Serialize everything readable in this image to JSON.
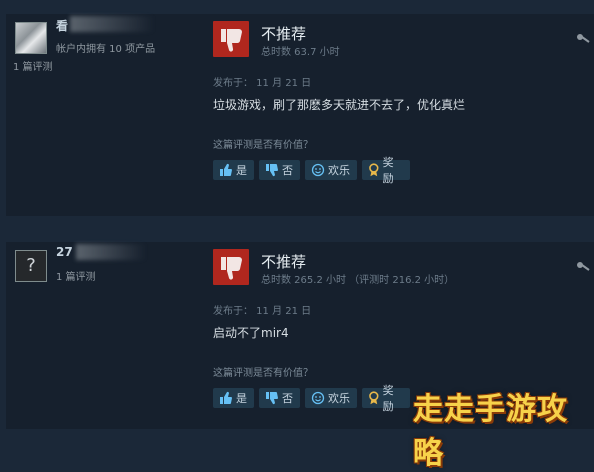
{
  "reviews": [
    {
      "user_name": "看",
      "products_owned": "帐户内拥有 10 项产品",
      "review_count": "1 篇评测",
      "verdict": "不推荐",
      "hours": "总时数 63.7 小时",
      "posted": "发布于： 11 月 21 日",
      "text": "垃圾游戏，刷了那麽多天就进不去了，优化真烂",
      "helpful_question": "这篇评测是否有价值？",
      "buttons": {
        "yes": "是",
        "no": "否",
        "funny": "欢乐",
        "award": "奖励"
      }
    },
    {
      "user_name": "27",
      "review_count": "1 篇评测",
      "verdict": "不推荐",
      "hours": "总时数 265.2 小时 （评测时 216.2 小时）",
      "posted": "发布于： 11 月 21 日",
      "text": "启动不了mir4",
      "helpful_question": "这篇评测是否有价值？",
      "buttons": {
        "yes": "是",
        "no": "否",
        "funny": "欢乐",
        "award": "奖励"
      }
    }
  ],
  "avatar_unknown_glyph": "?",
  "watermark": "走走手游攻略",
  "colors": {
    "page_bg": "#1b2838",
    "card_bg": "#16202d",
    "not_recommended": "#b0271e",
    "button_bg": "#213a4c",
    "watermark": "#f7d24a"
  },
  "icons": [
    "thumbs-down-icon",
    "share-icon",
    "thumbs-up-icon",
    "smile-icon",
    "award-icon"
  ]
}
